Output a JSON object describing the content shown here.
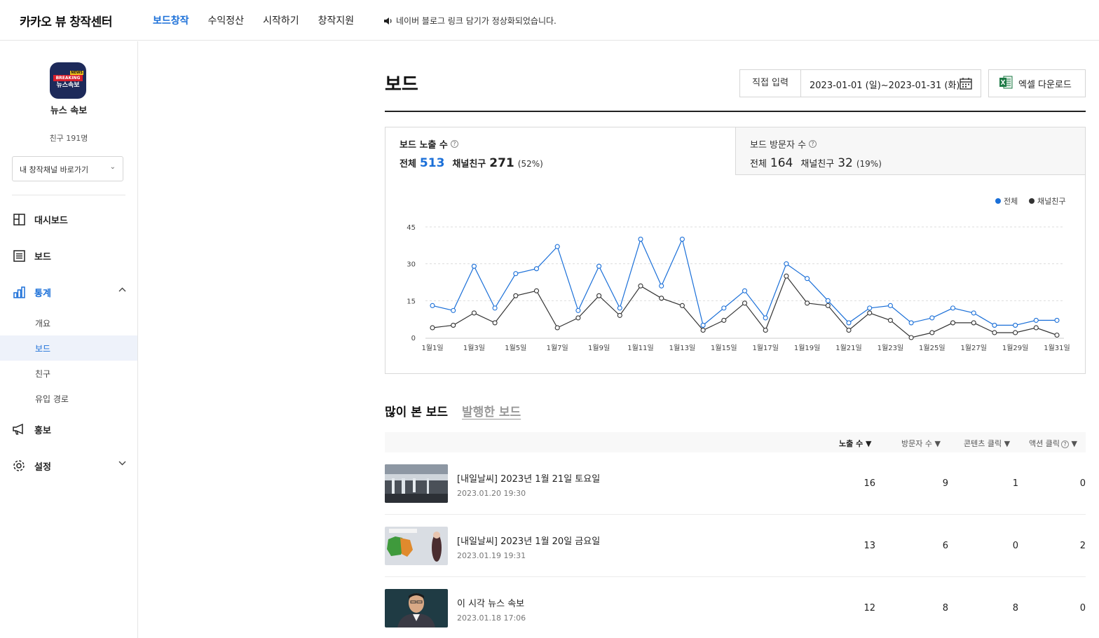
{
  "header": {
    "brand": "카카오 뷰 창작센터",
    "nav": [
      "보드창작",
      "수익정산",
      "시작하기",
      "창작지원"
    ],
    "active_nav": "보드창작",
    "notice": "네이버 블로그 링크 담기가 정상화되었습니다."
  },
  "sidebar": {
    "avatar": {
      "badge": "NEWS",
      "line1": "BREAKING",
      "line2": "뉴스속보"
    },
    "channel_name": "뉴스 속보",
    "friends": "친구 191명",
    "goto_label": "내 창작채널 바로가기",
    "menu": {
      "dashboard": "대시보드",
      "board": "보드",
      "stats": "통계",
      "stats_sub": [
        "개요",
        "보드",
        "친구",
        "유입 경로"
      ],
      "promo": "홍보",
      "settings": "설정"
    }
  },
  "main": {
    "title": "보드",
    "direct_input": "직접 입력",
    "date_range": "2023-01-01 (일)~2023-01-31 (화)",
    "excel_download": "엑셀 다운로드",
    "stats": {
      "exposure": {
        "label": "보드 노출 수",
        "total_label": "전체",
        "total": "513",
        "friends_label": "채널친구",
        "friends": "271",
        "pct": "(52%)"
      },
      "visitors": {
        "label": "보드 방문자 수",
        "total_label": "전체",
        "total": "164",
        "friends_label": "채널친구",
        "friends": "32",
        "pct": "(19%)"
      }
    },
    "list_tabs": {
      "popular": "많이 본 보드",
      "published": "발행한 보드"
    },
    "table": {
      "headers": [
        "노출 수",
        "방문자 수",
        "콘텐츠 클릭",
        "액션 클릭"
      ],
      "rows": [
        {
          "title": "[내일날씨] 2023년 1월 21일 토요일",
          "date": "2023.01.20 19:30",
          "exposure": "16",
          "visitors": "9",
          "content_clicks": "1",
          "action_clicks": "0",
          "thumb": "frozen-bridge"
        },
        {
          "title": "[내일날씨] 2023년 1월 20일 금요일",
          "date": "2023.01.19 19:31",
          "exposure": "13",
          "visitors": "6",
          "content_clicks": "0",
          "action_clicks": "2",
          "thumb": "weather-map"
        },
        {
          "title": "이 시각 뉴스 속보",
          "date": "2023.01.18 17:06",
          "exposure": "12",
          "visitors": "8",
          "content_clicks": "8",
          "action_clicks": "0",
          "thumb": "person-portrait"
        }
      ]
    }
  },
  "chart_data": {
    "type": "line",
    "x": [
      "1월1일",
      "1월2일",
      "1월3일",
      "1월4일",
      "1월5일",
      "1월6일",
      "1월7일",
      "1월8일",
      "1월9일",
      "1월10일",
      "1월11일",
      "1월12일",
      "1월13일",
      "1월14일",
      "1월15일",
      "1월16일",
      "1월17일",
      "1월18일",
      "1월19일",
      "1월20일",
      "1월21일",
      "1월22일",
      "1월23일",
      "1월24일",
      "1월25일",
      "1월26일",
      "1월27일",
      "1월28일",
      "1월29일",
      "1월30일",
      "1월31일"
    ],
    "x_tick_labels": [
      "1월1일",
      "1월3일",
      "1월5일",
      "1월7일",
      "1월9일",
      "1월11일",
      "1월13일",
      "1월15일",
      "1월17일",
      "1월19일",
      "1월21일",
      "1월23일",
      "1월25일",
      "1월27일",
      "1월29일",
      "1월31일"
    ],
    "series": [
      {
        "name": "전체",
        "color": "#1a6fd8",
        "values": [
          13,
          11,
          29,
          12,
          26,
          28,
          37,
          11,
          29,
          12,
          40,
          21,
          40,
          5,
          12,
          19,
          8,
          30,
          24,
          15,
          6,
          12,
          13,
          6,
          8,
          12,
          10,
          5,
          5,
          7,
          7
        ]
      },
      {
        "name": "채널친구",
        "color": "#333333",
        "values": [
          4,
          5,
          10,
          6,
          17,
          19,
          4,
          8,
          17,
          9,
          21,
          16,
          13,
          3,
          7,
          14,
          3,
          25,
          14,
          13,
          3,
          10,
          7,
          0,
          2,
          6,
          6,
          2,
          2,
          4,
          1
        ]
      }
    ],
    "yticks": [
      0,
      15,
      30,
      45
    ],
    "ylim": [
      0,
      45
    ],
    "legend_position": "top-right",
    "grid": true
  }
}
